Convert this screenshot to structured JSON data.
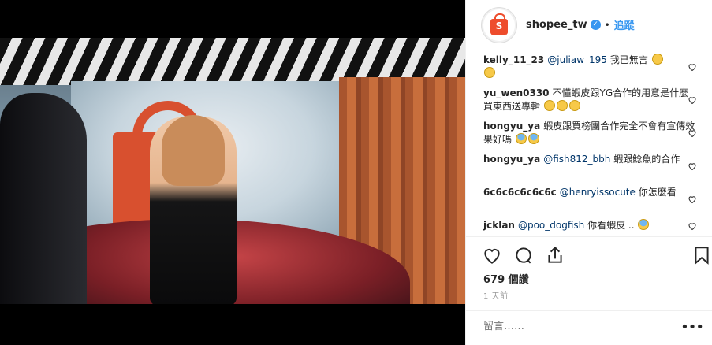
{
  "post": {
    "username": "shopee_tw",
    "avatar_caption": "蝦皮購物",
    "avatar_letter": "S",
    "verified_icon": "verified-badge-icon",
    "separator": "•",
    "follow_label": "追蹤"
  },
  "comments": [
    {
      "author": "kelly_11_23",
      "mention": "@juliaw_195",
      "text": " 我已無言",
      "emoji": [
        "unamused-emoji",
        "unamused-emoji"
      ]
    },
    {
      "author": "yu_wen0330",
      "mention": "",
      "text": "不懂蝦皮跟YG合作的用意是什麼 買東西送專輯",
      "emoji": [
        "thinking-emoji",
        "thinking-emoji",
        "thinking-emoji"
      ]
    },
    {
      "author": "hongyu_ya",
      "mention": "",
      "text": "蝦皮跟買榜團合作完全不會有宣傳效果好嗎",
      "emoji": [
        "fearful-emoji",
        "fearful-emoji"
      ]
    },
    {
      "author": "hongyu_ya",
      "mention": "@fish812_bbh",
      "text": " 蝦跟鯰魚的合作",
      "emoji": []
    },
    {
      "author": "6c6c6c6c6c6c",
      "mention": "@henryissocute",
      "text": " 你怎麼看",
      "emoji": []
    },
    {
      "author": "jcklan",
      "mention": "@poo_dogfish",
      "text": " 你看蝦皮 ..",
      "emoji": [
        "scream-emoji"
      ]
    }
  ],
  "actions": {
    "like_icon": "heart-icon",
    "comment_icon": "comment-icon",
    "share_icon": "share-icon",
    "save_icon": "bookmark-icon"
  },
  "likes": "679 個讚",
  "timestamp": "1 天前",
  "comment_box": {
    "placeholder": "留言……",
    "more_icon": "more-options-icon",
    "more_label": "•••"
  },
  "colors": {
    "accent": "#3897f0",
    "brand": "#ee4d2d",
    "border": "#efefef",
    "muted": "#999999"
  }
}
